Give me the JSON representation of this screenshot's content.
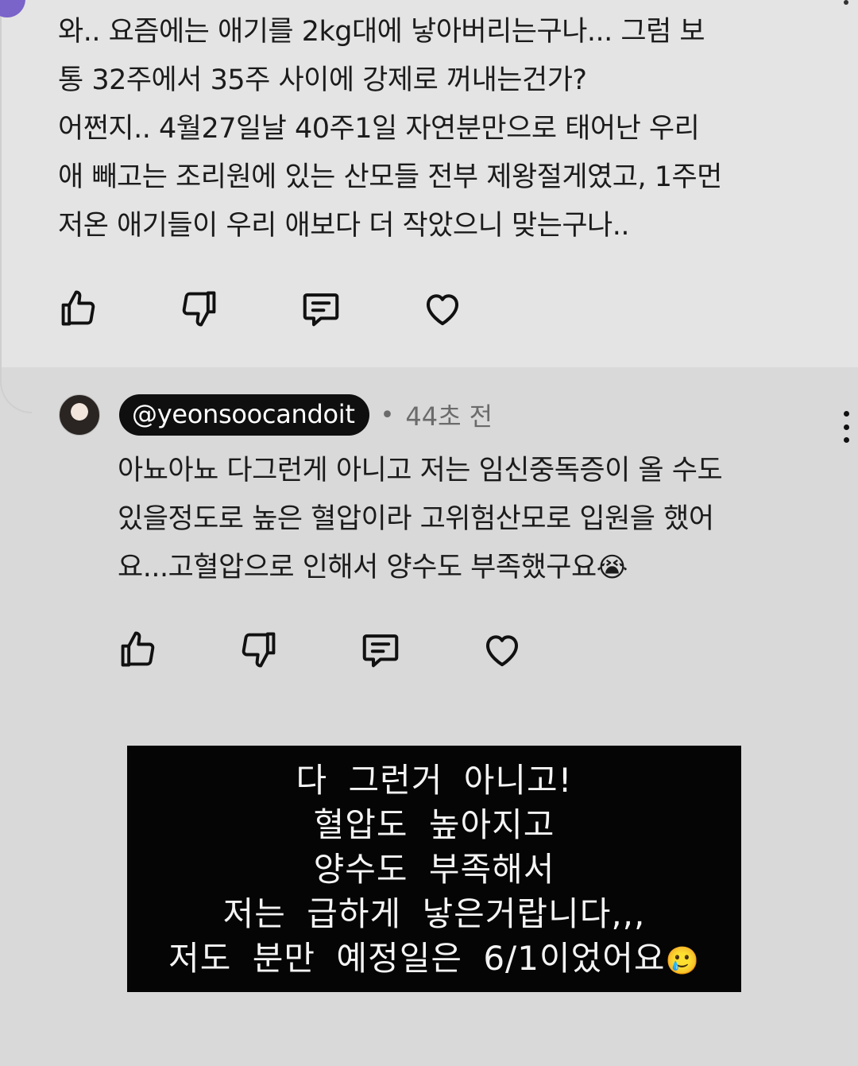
{
  "top_comment": {
    "lines": [
      "와.. 요즘에는 애기를 2kg대에 낳아버리는구나... 그럼 보",
      "통 32주에서 35주 사이에 강제로 꺼내는건가?",
      "어쩐지.. 4월27일날 40주1일 자연분만으로 태어난 우리",
      "애 빼고는 조리원에 있는 산모들 전부 제왕절게였고, 1주먼",
      "저온 애기들이 우리 애보다 더 작았으니 맞는구나.."
    ]
  },
  "reply": {
    "handle": "@yeonsoocandoit",
    "separator": "•",
    "time": "44초 전",
    "lines": [
      "아뇨아뇨 다그런게 아니고 저는 임신중독증이 올 수도",
      "있을정도로 높은 혈압이라 고위험산모로 입원을 했어",
      "요...고혈압으로 인해서 양수도 부족했구요"
    ],
    "emoji": "😭"
  },
  "caption": {
    "lines": [
      "다 그런거 아니고!",
      "혈압도 높아지고",
      "양수도 부족해서",
      "저는 급하게 낳은거랍니다,,,",
      "저도 분만 예정일은 6/1이었어요"
    ],
    "emoji": "🥲"
  },
  "icons": [
    "thumbs-up-icon",
    "thumbs-down-icon",
    "reply-icon",
    "heart-icon",
    "more-vert-icon"
  ],
  "colors": {
    "background": "#d9d9d9",
    "top_comment_bg": "#e4e4e4",
    "handle_pill": "#0f0f0f",
    "caption_bg": "#050505"
  }
}
